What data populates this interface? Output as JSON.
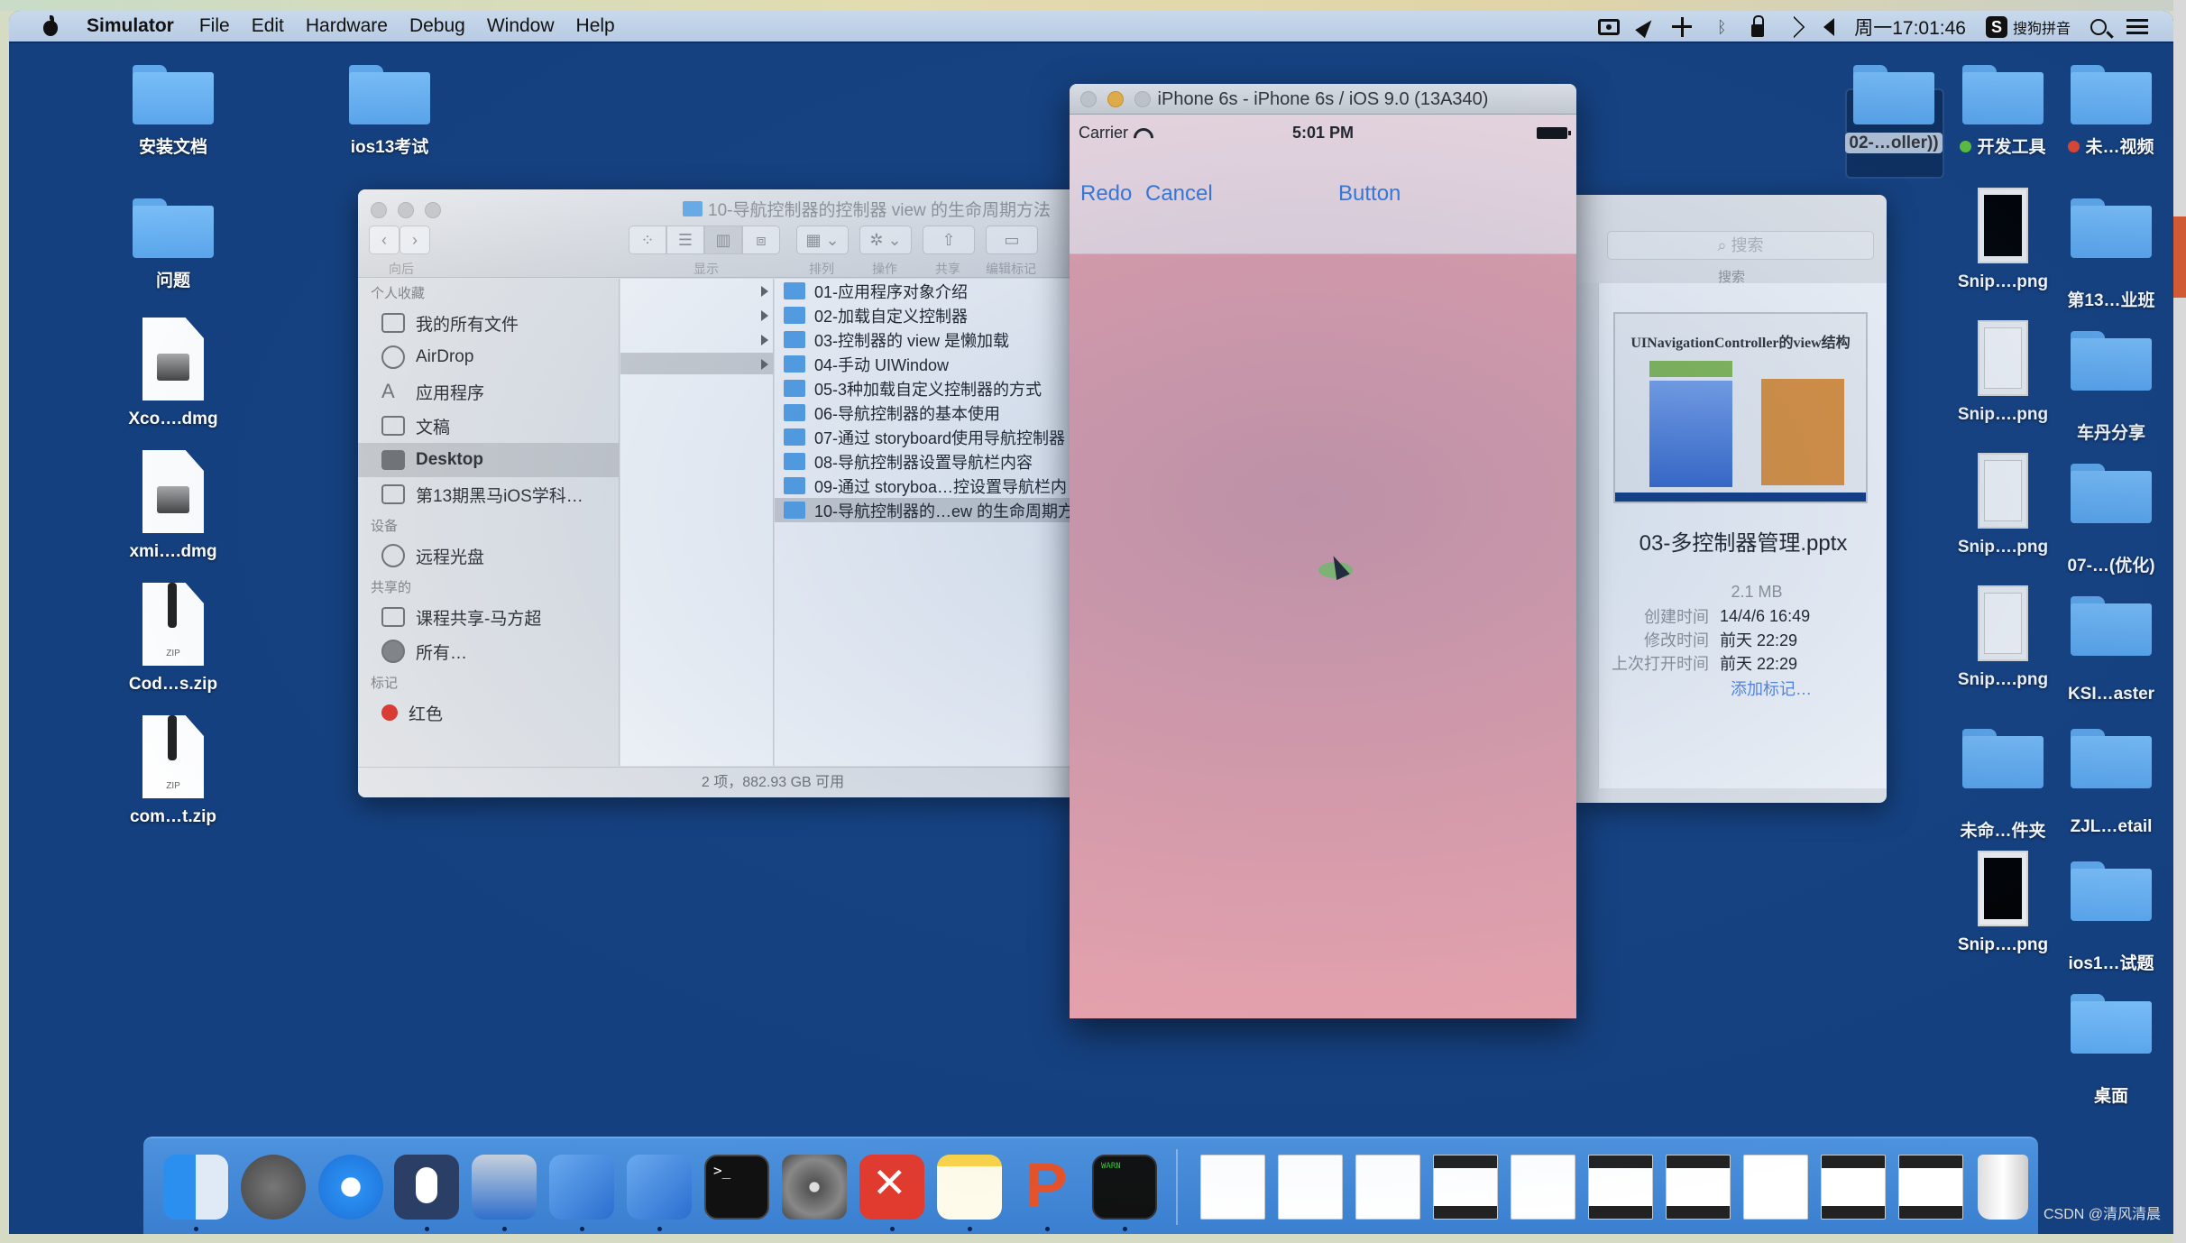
{
  "menubar": {
    "app": "Simulator",
    "items": [
      "File",
      "Edit",
      "Hardware",
      "Debug",
      "Window",
      "Help"
    ],
    "status_icons": [
      "screen-record-icon",
      "location-icon",
      "airplane-icon",
      "bluetooth-icon",
      "lock-icon",
      "wifi-icon",
      "volume-icon"
    ],
    "clock": "周一17:01:46",
    "ime_badge": "S",
    "ime_label": "搜狗拼音"
  },
  "desktop_left": [
    {
      "label": "安装文档",
      "type": "folder"
    },
    {
      "label": "ios13考试",
      "type": "folder"
    },
    {
      "label": "问题",
      "type": "folder"
    },
    {
      "label": "Xco….dmg",
      "type": "dmg"
    },
    {
      "label": "xmi….dmg",
      "type": "dmg"
    },
    {
      "label": "Cod…s.zip",
      "type": "zip"
    },
    {
      "label": "com…t.zip",
      "type": "zip"
    }
  ],
  "desktop_right": [
    {
      "label": "02-…oller))",
      "type": "folder",
      "selected": true
    },
    {
      "label": "开发工具",
      "type": "folder",
      "tag": "#5cc33a"
    },
    {
      "label": "未…视频",
      "type": "folder",
      "tag": "#e2452d"
    },
    {
      "label": "Snip….png",
      "type": "image-dark"
    },
    {
      "label": "第13…业班",
      "type": "folder"
    },
    {
      "label": "Snip….png",
      "type": "image-light"
    },
    {
      "label": "车丹分享",
      "type": "folder"
    },
    {
      "label": "Snip….png",
      "type": "image-light"
    },
    {
      "label": "07-…(优化)",
      "type": "folder"
    },
    {
      "label": "Snip….png",
      "type": "image-light"
    },
    {
      "label": "KSI…aster",
      "type": "folder"
    },
    {
      "label": "未命…件夹",
      "type": "folder"
    },
    {
      "label": "ZJL…etail",
      "type": "folder"
    },
    {
      "label": "Snip….png",
      "type": "image-dark"
    },
    {
      "label": "ios1…试题",
      "type": "folder"
    },
    {
      "label": "桌面",
      "type": "folder"
    }
  ],
  "finder": {
    "title": "10-导航控制器的控制器 view 的生命周期方法",
    "toolbar": {
      "back_forward_caption": "向后",
      "view_caption": "显示",
      "arrange_caption": "排列",
      "action_caption": "操作",
      "share_caption": "共享",
      "tags_caption": "编辑标记",
      "selected_view": "columns"
    },
    "sidebar": {
      "favorites_header": "个人收藏",
      "favorites": [
        {
          "label": "我的所有文件",
          "icon": "all-files-icon"
        },
        {
          "label": "AirDrop",
          "icon": "airdrop-icon"
        },
        {
          "label": "应用程序",
          "icon": "applications-icon"
        },
        {
          "label": "文稿",
          "icon": "documents-icon"
        },
        {
          "label": "Desktop",
          "icon": "desktop-icon",
          "active": true
        },
        {
          "label": "第13期黑马iOS学科…",
          "icon": "folder-icon"
        }
      ],
      "devices_header": "设备",
      "devices": [
        {
          "label": "远程光盘",
          "icon": "remote-disc-icon"
        }
      ],
      "shared_header": "共享的",
      "shared": [
        {
          "label": "课程共享-马方超",
          "icon": "computer-icon"
        },
        {
          "label": "所有…",
          "icon": "network-icon"
        }
      ],
      "tags_header": "标记",
      "tags": [
        {
          "label": "红色",
          "color": "#e43b2e"
        }
      ]
    },
    "column3": [
      "01-应用程序对象介绍",
      "02-加载自定义控制器",
      "03-控制器的 view 是懒加载",
      "04-手动 UIWindow",
      "05-3种加载自定义控制器的方式",
      "06-导航控制器的基本使用",
      "07-通过 storyboard使用导航控制器",
      "08-导航控制器设置导航栏内容",
      "09-通过 storyboa…控设置导航栏内",
      "10-导航控制器的…ew 的生命周期方"
    ],
    "column3_selected_index": 9,
    "status": "2 项，882.93 GB 可用"
  },
  "preview": {
    "search_placeholder": "搜索",
    "search_caption": "搜索",
    "slide_title": "UINavigationController的view结构",
    "file_name": "03-多控制器管理.pptx",
    "size": "2.1 MB",
    "meta": [
      {
        "key": "创建时间",
        "value": "14/4/6 16:49"
      },
      {
        "key": "修改时间",
        "value": "前天 22:29"
      },
      {
        "key": "上次打开时间",
        "value": "前天 22:29"
      }
    ],
    "add_tag": "添加标记…"
  },
  "simulator": {
    "title": "iPhone 6s - iPhone 6s / iOS 9.0 (13A340)",
    "carrier": "Carrier",
    "time": "5:01 PM",
    "nav_left": [
      "Redo",
      "Cancel"
    ],
    "nav_right": "Button",
    "view_color": "#f2a7ae",
    "navbar_color": "#fbe3e6",
    "tint_color": "#3a7de0"
  },
  "dock": {
    "apps": [
      "Finder",
      "Launchpad",
      "Safari",
      "Mouse",
      "iMovie/Screen",
      "Xcode",
      "Simulator",
      "Terminal",
      "System Preferences",
      "XMind",
      "Notes",
      "PowerPoint",
      "Console"
    ],
    "minimized_windows": 10,
    "trash": "Trash"
  },
  "watermark": "CSDN @清风清晨"
}
